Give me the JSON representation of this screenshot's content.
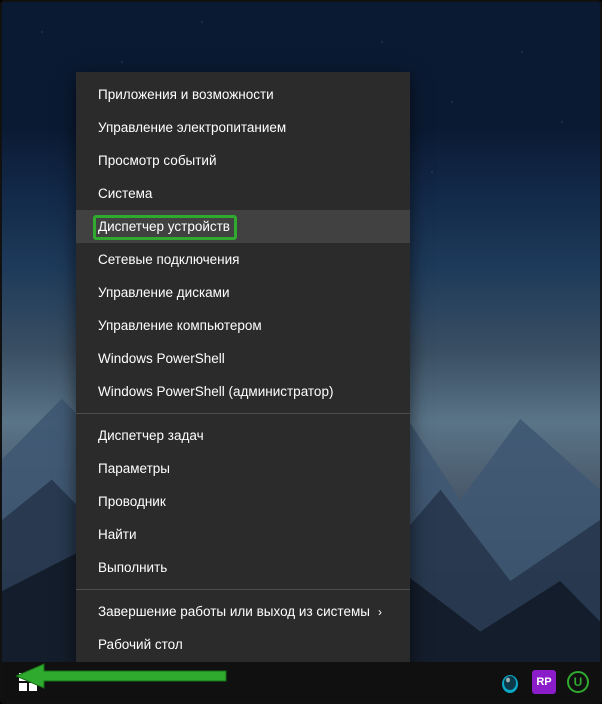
{
  "menu": {
    "items": [
      {
        "label": "Приложения и возможности",
        "hasSubmenu": false
      },
      {
        "label": "Управление электропитанием",
        "hasSubmenu": false
      },
      {
        "label": "Просмотр событий",
        "hasSubmenu": false
      },
      {
        "label": "Система",
        "hasSubmenu": false
      },
      {
        "label": "Диспетчер устройств",
        "hasSubmenu": false,
        "highlighted": true
      },
      {
        "label": "Сетевые подключения",
        "hasSubmenu": false
      },
      {
        "label": "Управление дисками",
        "hasSubmenu": false
      },
      {
        "label": "Управление компьютером",
        "hasSubmenu": false
      },
      {
        "label": "Windows PowerShell",
        "hasSubmenu": false
      },
      {
        "label": "Windows PowerShell (администратор)",
        "hasSubmenu": false
      },
      {
        "separator": true
      },
      {
        "label": "Диспетчер задач",
        "hasSubmenu": false
      },
      {
        "label": "Параметры",
        "hasSubmenu": false
      },
      {
        "label": "Проводник",
        "hasSubmenu": false
      },
      {
        "label": "Найти",
        "hasSubmenu": false
      },
      {
        "label": "Выполнить",
        "hasSubmenu": false
      },
      {
        "separator": true
      },
      {
        "label": "Завершение работы или выход из системы",
        "hasSubmenu": true
      },
      {
        "label": "Рабочий стол",
        "hasSubmenu": false
      }
    ]
  },
  "tray": {
    "rp_label": "RP",
    "u_label": "U"
  },
  "colors": {
    "accent_green": "#2faa2f",
    "menu_bg": "#2b2b2b",
    "menu_highlight": "#414141"
  }
}
